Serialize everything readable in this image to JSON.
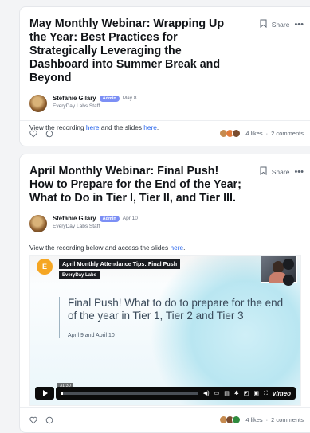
{
  "posts": [
    {
      "title": "May Monthly Webinar: Wrapping Up the Year: Best Practices for Strategically Leveraging the Dashboard into Summer Break and Beyond",
      "share_label": "Share",
      "author": {
        "name": "Stefanie Gilary",
        "badge": "Admin",
        "date": "May 8",
        "subtitle": "EveryDay Labs Staff"
      },
      "body": {
        "prefix": "View the recording ",
        "link1": "here",
        "middle": " and the slides ",
        "link2": "here",
        "suffix": "."
      },
      "stats": {
        "likes": "4 likes",
        "separator": "·",
        "comments": "2 comments"
      }
    },
    {
      "title": "April Monthly Webinar: Final Push! How to Prepare for the End of the Year; What to Do in Tier I, Tier II, and Tier III.",
      "share_label": "Share",
      "author": {
        "name": "Stefanie Gilary",
        "badge": "Admin",
        "date": "Apr 10",
        "subtitle": "EveryDay Labs Staff"
      },
      "body": {
        "prefix": "View the recording below and access the slides ",
        "link1": "here",
        "suffix": "."
      },
      "video": {
        "badge_letter": "E",
        "title": "April Monthly Attendance Tips: Final Push",
        "channel": "EveryDay Labs",
        "headline": "Final Push! What to do to prepare for the end of the year in Tier 1, Tier 2 and Tier 3",
        "subline": "April 9 and April 10",
        "timecode": "31:30",
        "brand": "vimeo",
        "progress": 0.015
      },
      "stats": {
        "likes": "4 likes",
        "separator": "·",
        "comments": "2 comments"
      }
    }
  ],
  "icons": {
    "more": "more-horizontal-icon",
    "bookmark": "bookmark-icon",
    "like": "heart-icon",
    "comment": "comment-icon"
  },
  "colors": {
    "link": "#2563eb",
    "admin_badge": "#7c8ff5"
  }
}
